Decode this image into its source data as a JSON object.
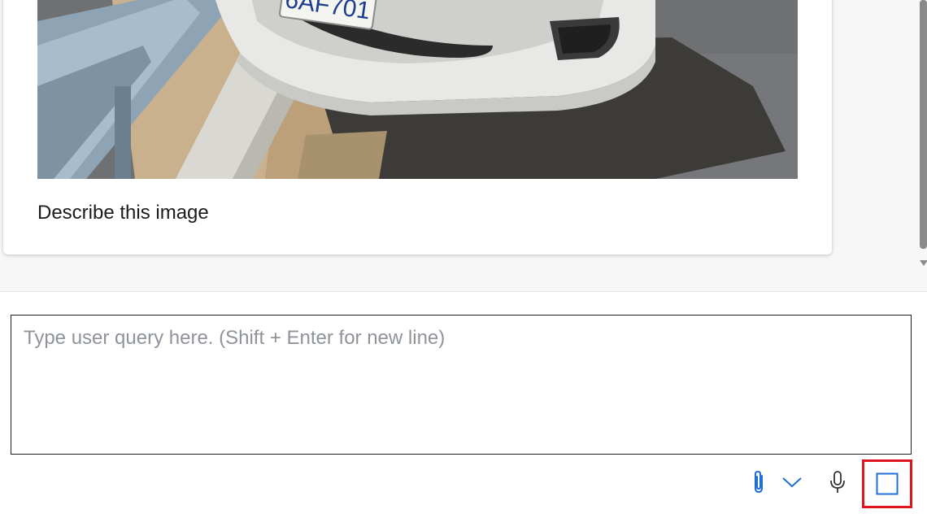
{
  "conversation": {
    "message": {
      "text": "Describe this image",
      "image": {
        "plate_text": "6AF701"
      }
    }
  },
  "composer": {
    "placeholder": "Type user query here. (Shift + Enter for new line)",
    "value": ""
  },
  "toolbar": {
    "attach_icon": "paperclip-icon",
    "dropdown_icon": "chevron-down-icon",
    "mic_icon": "microphone-icon",
    "stop_icon": "stop-square-icon",
    "accent_color": "#1f6fd6",
    "highlight_color": "#e0141e"
  }
}
